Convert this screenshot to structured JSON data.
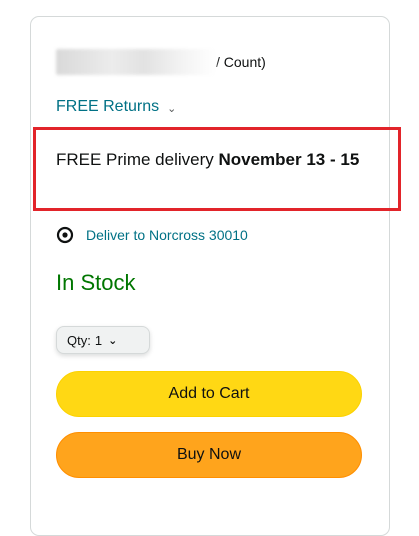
{
  "price": {
    "suffix": "/ Count)"
  },
  "returns": {
    "label": "FREE Returns",
    "chevron_icon": "chevron-down-icon"
  },
  "delivery": {
    "prefix": "FREE Prime delivery ",
    "dates": "November 13 - 15"
  },
  "location": {
    "icon": "location-pin-icon",
    "label": "Deliver to Norcross 30010"
  },
  "stock": {
    "label": "In Stock",
    "color": "#007600"
  },
  "quantity": {
    "label": "Qty:",
    "value": "1"
  },
  "buttons": {
    "add_to_cart": "Add to Cart",
    "buy_now": "Buy Now"
  },
  "colors": {
    "add_to_cart": "#FFD814",
    "buy_now": "#FFA41C",
    "link": "#007185",
    "highlight": "#e2242a"
  }
}
